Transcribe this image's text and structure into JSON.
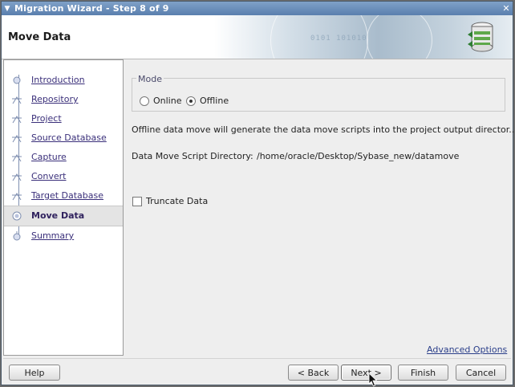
{
  "window": {
    "title": "Migration Wizard - Step 8 of 9",
    "menu_icon": "dropdown-arrow-icon",
    "close_icon": "close-icon"
  },
  "header": {
    "page_title": "Move Data",
    "banner_bits": "0101 101010",
    "icon": "database-migrate-icon"
  },
  "steps": [
    {
      "label": "Introduction",
      "current": false
    },
    {
      "label": "Repository",
      "current": false
    },
    {
      "label": "Project",
      "current": false
    },
    {
      "label": "Source Database",
      "current": false
    },
    {
      "label": "Capture",
      "current": false
    },
    {
      "label": "Convert",
      "current": false
    },
    {
      "label": "Target Database",
      "current": false
    },
    {
      "label": "Move Data",
      "current": true
    },
    {
      "label": "Summary",
      "current": false
    }
  ],
  "mode": {
    "legend": "Mode",
    "online_label": "Online",
    "offline_label": "Offline",
    "selected": "Offline"
  },
  "description": "Offline data move will generate the  data move scripts into the project output director...",
  "script_directory": {
    "label": "Data Move Script Directory:",
    "value": "/home/oracle/Desktop/Sybase_new/datamove"
  },
  "truncate": {
    "label": "Truncate Data",
    "checked": false
  },
  "advanced_options": "Advanced Options",
  "buttons": {
    "help": "Help",
    "back": "< Back",
    "next": "Next >",
    "finish": "Finish",
    "cancel": "Cancel"
  }
}
